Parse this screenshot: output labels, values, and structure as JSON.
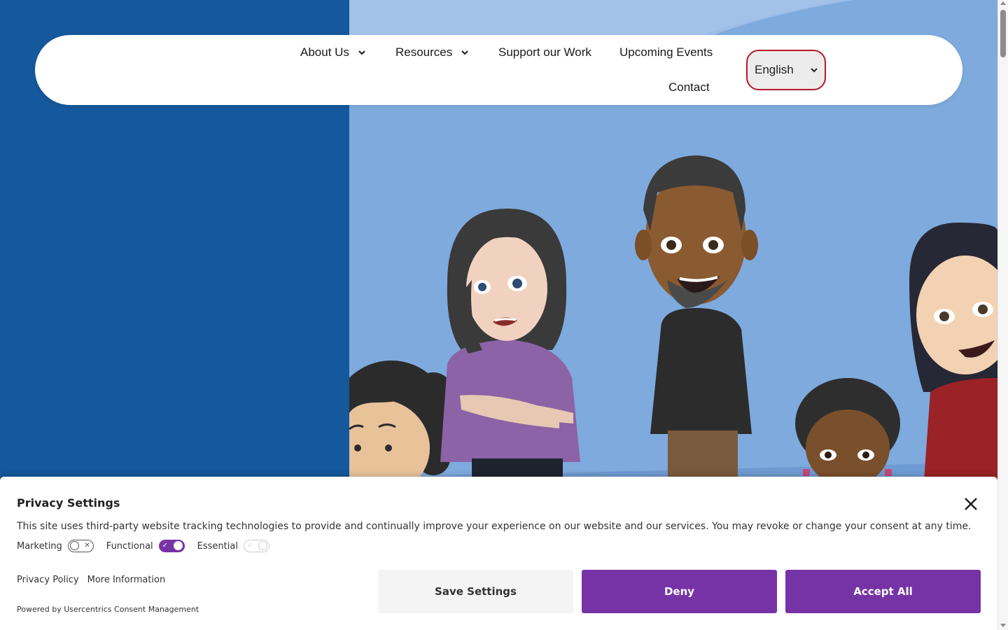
{
  "nav": {
    "items": [
      {
        "label": "About Us",
        "has_dropdown": true
      },
      {
        "label": "Resources",
        "has_dropdown": true
      },
      {
        "label": "Support our Work",
        "has_dropdown": false
      },
      {
        "label": "Upcoming Events",
        "has_dropdown": false
      },
      {
        "label": "Contact",
        "has_dropdown": false
      }
    ],
    "language": {
      "selected": "English"
    }
  },
  "colors": {
    "left_panel": "#15589c",
    "hero_background": "#7eaadd",
    "accent_purple": "#7633a6",
    "language_border": "#b5192a"
  },
  "consent": {
    "title": "Privacy Settings",
    "description": "This site uses third-party website tracking technologies to provide and continually improve your experience on our website and our services. You may revoke or change your consent at any time.",
    "toggles": [
      {
        "label": "Marketing",
        "state": "off"
      },
      {
        "label": "Functional",
        "state": "on"
      },
      {
        "label": "Essential",
        "state": "on-disabled"
      }
    ],
    "links": {
      "privacy_policy": "Privacy Policy",
      "more_information": "More Information"
    },
    "powered_by": "Powered by Usercentrics Consent Management",
    "buttons": {
      "save": "Save Settings",
      "deny": "Deny",
      "accept": "Accept All"
    }
  }
}
